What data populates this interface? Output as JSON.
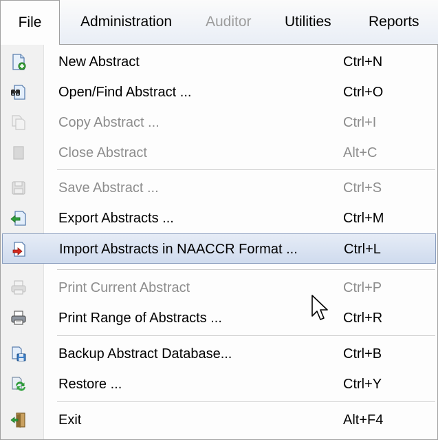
{
  "menubar": {
    "items": [
      {
        "label": "File"
      },
      {
        "label": "Administration"
      },
      {
        "label": "Auditor"
      },
      {
        "label": "Utilities"
      },
      {
        "label": "Reports"
      }
    ]
  },
  "file_menu": {
    "items": [
      {
        "label": "New Abstract",
        "shortcut": "Ctrl+N",
        "icon": "new-document-icon"
      },
      {
        "label": "Open/Find Abstract ...",
        "shortcut": "Ctrl+O",
        "icon": "binoculars-document-icon"
      },
      {
        "label": "Copy Abstract ...",
        "shortcut": "Ctrl+I",
        "icon": "copy-icon",
        "disabled": true
      },
      {
        "label": "Close Abstract",
        "shortcut": "Alt+C",
        "icon": "close-document-icon",
        "disabled": true
      },
      {
        "label": "Save Abstract ...",
        "shortcut": "Ctrl+S",
        "icon": "floppy-disk-icon",
        "disabled": true
      },
      {
        "label": "Export Abstracts ...",
        "shortcut": "Ctrl+M",
        "icon": "export-arrow-icon"
      },
      {
        "label": "Import Abstracts in NAACCR Format ...",
        "shortcut": "Ctrl+L",
        "icon": "import-arrow-icon",
        "highlighted": true
      },
      {
        "label": "Print Current Abstract",
        "shortcut": "Ctrl+P",
        "icon": "printer-icon",
        "disabled": true
      },
      {
        "label": "Print Range of Abstracts ...",
        "shortcut": "Ctrl+R",
        "icon": "printer-icon"
      },
      {
        "label": "Backup Abstract Database...",
        "shortcut": "Ctrl+B",
        "icon": "database-backup-icon"
      },
      {
        "label": "Restore ...",
        "shortcut": "Ctrl+Y",
        "icon": "restore-arrows-icon"
      },
      {
        "label": "Exit",
        "shortcut": "Alt+F4",
        "icon": "exit-door-icon"
      }
    ]
  }
}
